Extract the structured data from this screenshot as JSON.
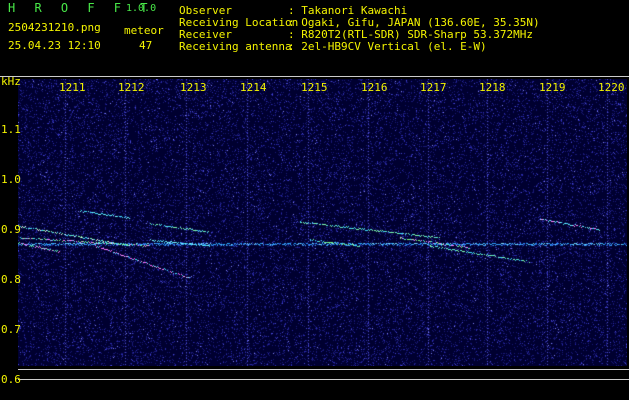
{
  "header": {
    "app_name": "H R O F F T",
    "version": "1.0.0",
    "filename": "2504231210.png",
    "meteor_label": "meteor",
    "datetime": "25.04.23 12:10",
    "meteor_count": "47"
  },
  "info": {
    "observer_key": "Observer",
    "observer_value": ": Takanori Kawachi",
    "location_key": "Receiving Location",
    "location_value": ": Ogaki, Gifu, JAPAN (136.60E, 35.35N)",
    "receiver_key": "Receiver",
    "receiver_value": ": R820T2(RTL-SDR) SDR-Sharp 53.372MHz",
    "antenna_key": "Receiving antenna",
    "antenna_value": ": 2el-HB9CV Vertical (el. E-W)"
  },
  "spectrogram": {
    "unit_label": "kHz",
    "time_ticks": [
      "1211",
      "1212",
      "1213",
      "1214",
      "1215",
      "1216",
      "1217",
      "1218",
      "1219",
      "1220"
    ],
    "freq_ticks": [
      "1.1",
      "1.0",
      "0.9",
      "0.8",
      "0.7",
      "0.6"
    ],
    "carrier_khz": 0.87,
    "colors": {
      "background": "#000030",
      "noise": "#2a2aa0",
      "trace": "#20c8ff",
      "label": "#f4f400"
    }
  }
}
